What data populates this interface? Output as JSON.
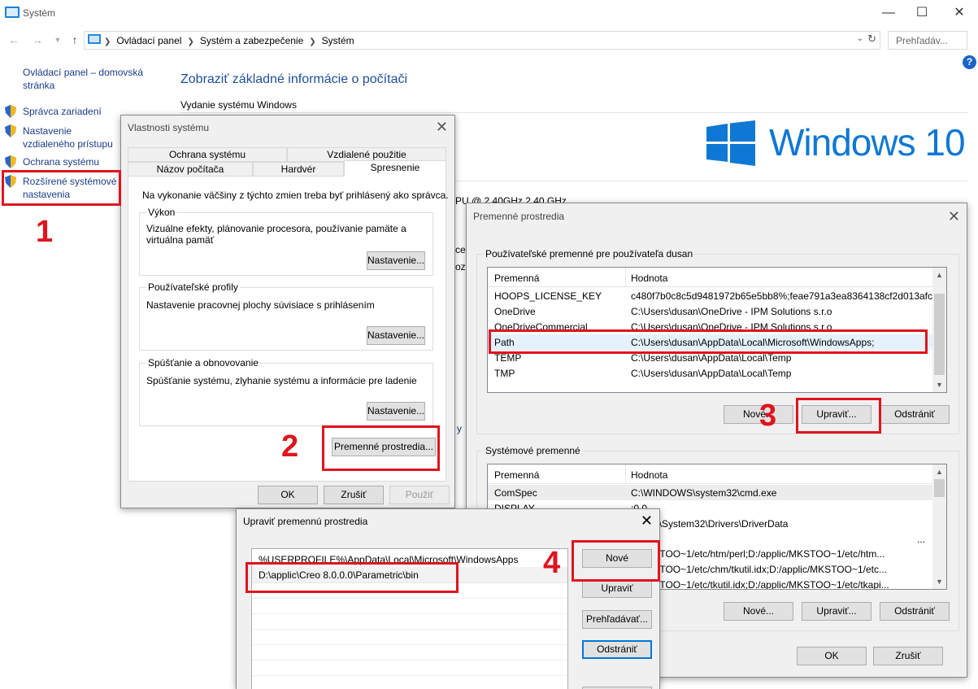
{
  "main": {
    "title": "Systém",
    "breadcrumb": [
      "Ovládací panel",
      "Systém a zabezpečenie",
      "Systém"
    ],
    "search_placeholder": "Prehľadáv...",
    "help": "?",
    "heading": "Zobraziť základné informácie o počítači",
    "edition_label": "Vydanie systému Windows",
    "windows_logo_text": "Windows 10",
    "processor_peek": "PU @ 2.40GHz   2.40 GHz",
    "peek1": "ces",
    "peek2": "ozí",
    "peek3": "y"
  },
  "leftnav": {
    "home": "Ovládací panel – domovská stránka",
    "items": [
      "Správca zariadení",
      "Nastavenie vzdialeného prístupu",
      "Ochrana systému",
      "Rozšírené systémové nastavenia"
    ]
  },
  "sysprops": {
    "title": "Vlastnosti systému",
    "tabs_row1": [
      "Ochrana systému",
      "Vzdialené použitie"
    ],
    "tabs_row2": [
      "Názov počítača",
      "Hardvér",
      "Spresnenie"
    ],
    "admin_note": "Na vykonanie väčšiny z týchto zmien treba byť prihlásený ako správca.",
    "groups": [
      {
        "legend": "Výkon",
        "text": "Vizuálne efekty, plánovanie procesora, používanie pamäte a virtuálna pamäť",
        "button": "Nastavenie..."
      },
      {
        "legend": "Používateľské profily",
        "text": "Nastavenie pracovnej plochy súvisiace s prihlásením",
        "button": "Nastavenie..."
      },
      {
        "legend": "Spúšťanie a obnovovanie",
        "text": "Spúšťanie systému, zlyhanie systému a informácie pre ladenie",
        "button": "Nastavenie..."
      }
    ],
    "env_button": "Premenné prostredia...",
    "ok": "OK",
    "cancel": "Zrušiť",
    "apply": "Použiť"
  },
  "envvars": {
    "title": "Premenné prostredia",
    "user_group": "Používateľské premenné pre používateľa dusan",
    "col_name": "Premenná",
    "col_value": "Hodnota",
    "user_rows": [
      {
        "name": "HOOPS_LICENSE_KEY",
        "value": "c480f7b0c8c5d9481972b65e5bb8%;feae791a3ea8364138cf2d013afcd..."
      },
      {
        "name": "OneDrive",
        "value": "C:\\Users\\dusan\\OneDrive - IPM Solutions s.r.o"
      },
      {
        "name": "OneDriveCommercial",
        "value": "C:\\Users\\dusan\\OneDrive - IPM Solutions s.r.o"
      },
      {
        "name": "Path",
        "value": "C:\\Users\\dusan\\AppData\\Local\\Microsoft\\WindowsApps;"
      },
      {
        "name": "TEMP",
        "value": "C:\\Users\\dusan\\AppData\\Local\\Temp"
      },
      {
        "name": "TMP",
        "value": "C:\\Users\\dusan\\AppData\\Local\\Temp"
      }
    ],
    "user_new": "Nové...",
    "user_edit": "Upraviť...",
    "user_delete": "Odstrániť",
    "sys_group": "Systémové premenné",
    "sys_rows": [
      {
        "name": "ComSpec",
        "value": "C:\\WINDOWS\\system32\\cmd.exe"
      },
      {
        "name": "DISPLAY",
        "value": ":0.0"
      },
      {
        "name": "",
        "value": "ndows\\System32\\Drivers\\DriverData"
      },
      {
        "name": "",
        "value": "..."
      },
      {
        "name": "",
        "value": "c/MKSTOO~1/etc/htm/perl;D:/applic/MKSTOO~1/etc/htm..."
      },
      {
        "name": "",
        "value": "c/MKSTOO~1/etc/chm/tkutil.idx;D:/applic/MKSTOO~1/etc..."
      },
      {
        "name": "",
        "value": "c/MKSTOO~1/etc/tkutil.idx;D:/applic/MKSTOO~1/etc/tkapi..."
      }
    ],
    "sys_new": "Nové...",
    "sys_edit": "Upraviť...",
    "sys_delete": "Odstrániť",
    "ok": "OK",
    "cancel": "Zrušiť"
  },
  "editvar": {
    "title": "Upraviť premennú prostredia",
    "entries": [
      "%USERPROFILE%\\AppData\\Local\\Microsoft\\WindowsApps",
      "D:\\applic\\Creo 8.0.0.0\\Parametric\\bin"
    ],
    "new": "Nové",
    "edit": "Upraviť",
    "browse": "Prehľadávať...",
    "delete": "Odstrániť"
  },
  "annotations": [
    "1",
    "2",
    "3",
    "4"
  ],
  "colors": {
    "accent": "#0078d7",
    "annotation": "#e0141e",
    "link": "#1a3a8a",
    "windows_blue": "#0f78d4"
  }
}
